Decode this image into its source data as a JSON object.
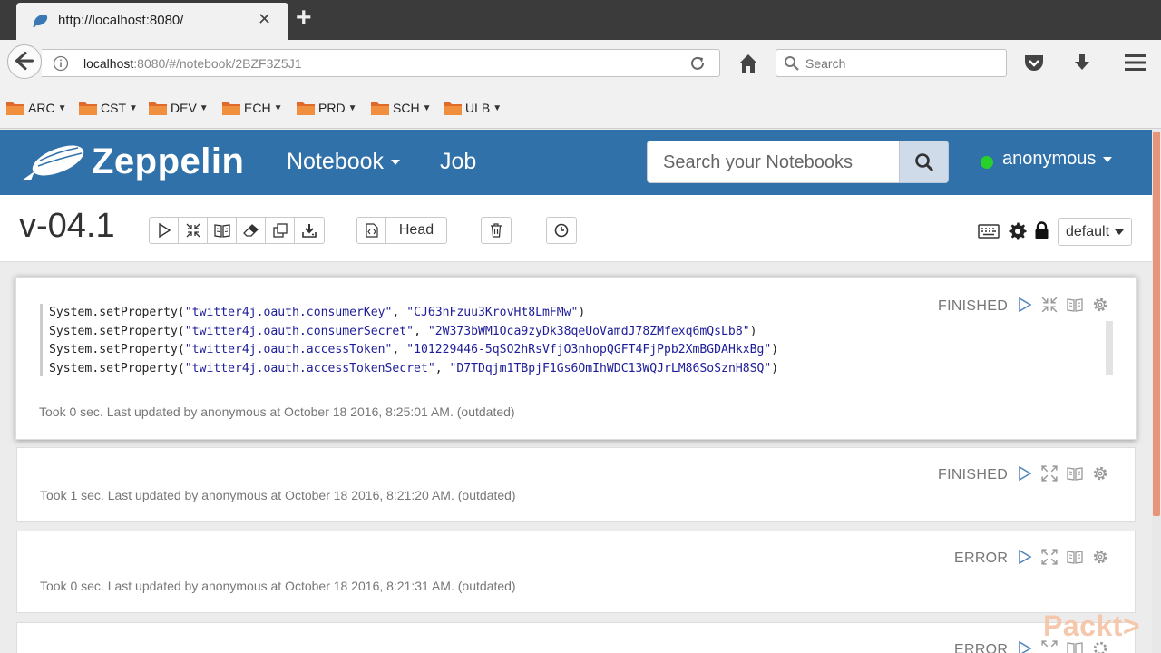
{
  "browser": {
    "tab_title": "http://localhost:8080/",
    "url_host": "localhost",
    "url_rest": ":8080/#/notebook/2BZF3Z5J1",
    "search_placeholder": "Search",
    "bookmarks": [
      "ARC",
      "CST",
      "DEV",
      "ECH",
      "PRD",
      "SCH",
      "ULB"
    ]
  },
  "zeppelin": {
    "brand": "Zeppelin",
    "nav_notebook": "Notebook",
    "nav_job": "Job",
    "search_placeholder": "Search your Notebooks",
    "user": "anonymous",
    "colors": {
      "header": "#3071a9",
      "online": "#27d02b"
    }
  },
  "notebook": {
    "title": "v-04.1",
    "head_label": "Head",
    "interpreter_label": "default",
    "toolbar_icons": [
      "run-all-icon",
      "collapse-code-icon",
      "show-output-icon",
      "clear-output-icon",
      "clone-icon",
      "export-icon",
      "version-control-icon",
      "delete-icon",
      "scheduler-icon",
      "keyboard-icon",
      "settings-icon",
      "lock-icon"
    ]
  },
  "paragraphs": [
    {
      "status": "FINISHED",
      "code": [
        {
          "obj": "System",
          "method": ".setProperty(",
          "key": "\"twitter4j.oauth.consumerKey\"",
          "sep": ", ",
          "val": "\"CJ63hFzuu3KrovHt8LmFMw\"",
          "end": ")"
        },
        {
          "obj": "System",
          "method": ".setProperty(",
          "key": "\"twitter4j.oauth.consumerSecret\"",
          "sep": ", ",
          "val": "\"2W373bWM1Oca9zyDk38qeUoVamdJ78ZMfexq6mQsLb8\"",
          "end": ")"
        },
        {
          "obj": "System",
          "method": ".setProperty(",
          "key": "\"twitter4j.oauth.accessToken\"",
          "sep": ", ",
          "val": "\"101229446-5qSO2hRsVfjO3nhopQGFT4FjPpb2XmBGDAHkxBg\"",
          "end": ")"
        },
        {
          "obj": "System",
          "method": ".setProperty(",
          "key": "\"twitter4j.oauth.accessTokenSecret\"",
          "sep": ", ",
          "val": "\"D7TDqjm1TBpjF1Gs6OmIhWDC13WQJrLM86SoSznH8SQ\"",
          "end": ")"
        }
      ],
      "footer": "Took 0 sec. Last updated by anonymous at October 18 2016, 8:25:01 AM. (outdated)"
    },
    {
      "status": "FINISHED",
      "footer": "Took 1 sec. Last updated by anonymous at October 18 2016, 8:21:20 AM. (outdated)"
    },
    {
      "status": "ERROR",
      "footer": "Took 0 sec. Last updated by anonymous at October 18 2016, 8:21:31 AM. (outdated)"
    },
    {
      "status": "ERROR"
    }
  ],
  "watermark": "Packt>"
}
